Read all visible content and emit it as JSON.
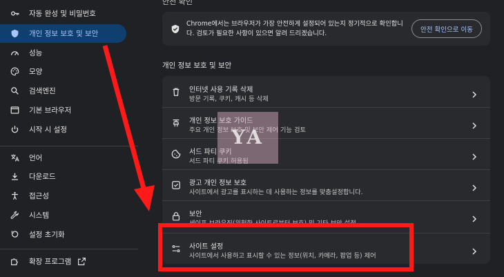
{
  "sidebar": {
    "items": [
      {
        "label": "자동 완성 및 비밀번호",
        "icon": "key-icon"
      },
      {
        "label": "개인 정보 보호 및 보안",
        "icon": "shield-icon",
        "active": true
      },
      {
        "label": "성능",
        "icon": "speedometer-icon"
      },
      {
        "label": "모양",
        "icon": "palette-icon"
      },
      {
        "label": "검색엔진",
        "icon": "search-icon"
      },
      {
        "label": "기본 브라우저",
        "icon": "browser-window-icon"
      },
      {
        "label": "시작 시 설정",
        "icon": "power-icon"
      },
      {
        "label": "언어",
        "icon": "translate-icon"
      },
      {
        "label": "다운로드",
        "icon": "download-icon"
      },
      {
        "label": "접근성",
        "icon": "accessibility-icon"
      },
      {
        "label": "시스템",
        "icon": "wrench-icon"
      },
      {
        "label": "설정 초기화",
        "icon": "reset-icon"
      },
      {
        "label": "확장 프로그램",
        "icon": "puzzle-icon"
      }
    ],
    "extensions_link_icon": "open-external-icon"
  },
  "top_section_title": "안전 확인",
  "safety_check": {
    "text": "Chrome에서는 브라우저가 가장 안전하게 설정되어 있는지 정기적으로 확인합니다. 검토가 필요한 사항이 있으면 알려 드리겠습니다.",
    "button": "안전 확인으로 이동"
  },
  "privacy_section": {
    "title": "개인 정보 보호 및 보안",
    "rows": [
      {
        "title": "인터넷 사용 기록 삭제",
        "subtitle": "방문 기록, 쿠키, 캐시 등 삭제",
        "icon": "trash-icon"
      },
      {
        "title": "개인 정보 보호 가이드",
        "subtitle": "주요 개인 정보 보호 및 보안 제어 기능 검토",
        "icon": "guide-icon"
      },
      {
        "title": "서드 파티 쿠키",
        "subtitle": "서드 파티 쿠키 허용됨",
        "icon": "cookie-icon"
      },
      {
        "title": "광고 개인 정보 보호",
        "subtitle": "사이트에서 광고를 표시하는 데 사용하는 정보를 맞춤설정합니다.",
        "icon": "ad-privacy-icon"
      },
      {
        "title": "보안",
        "subtitle": "세이프 브라우징(위험한 사이트로부터 보호) 및 기타 보안 설정",
        "icon": "lock-icon"
      },
      {
        "title": "사이트 설정",
        "subtitle": "사이트에서 사용하고 표시할 수 있는 정보(위치, 카메라, 팝업 등) 제어",
        "icon": "site-settings-icon"
      }
    ]
  },
  "watermark_text": "YA",
  "colors": {
    "background": "#202124",
    "card": "#292a2d",
    "active_nav": "#0f3f6e",
    "accent": "#a8c7fa",
    "annotation_red": "#ff1a1a"
  }
}
